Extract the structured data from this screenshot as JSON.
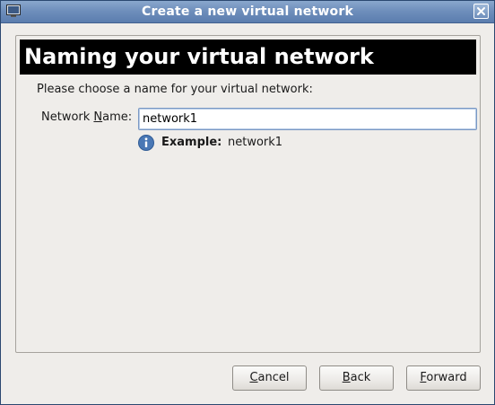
{
  "window": {
    "title": "Create a new virtual network"
  },
  "header": {
    "title": "Naming your virtual network"
  },
  "form": {
    "instructions": "Please choose a name for your virtual network:",
    "network_name_label_prefix": "Network ",
    "network_name_label_mnemonic": "N",
    "network_name_label_suffix": "ame:",
    "network_name_value": "network1",
    "hint_label": "Example:",
    "hint_value": "network1"
  },
  "buttons": {
    "cancel_mnemonic": "C",
    "cancel_rest": "ancel",
    "back_mnemonic": "B",
    "back_rest": "ack",
    "forward_mnemonic": "F",
    "forward_rest": "orward"
  },
  "icons": {
    "app": "computer-screen-icon",
    "close": "close-icon",
    "info": "info-icon"
  },
  "colors": {
    "titlebar": "#6f8fbc",
    "banner_bg": "#000000",
    "banner_text": "#ffffff",
    "info_icon": "#4a78b5",
    "input_focus_border": "#7b99c4"
  }
}
